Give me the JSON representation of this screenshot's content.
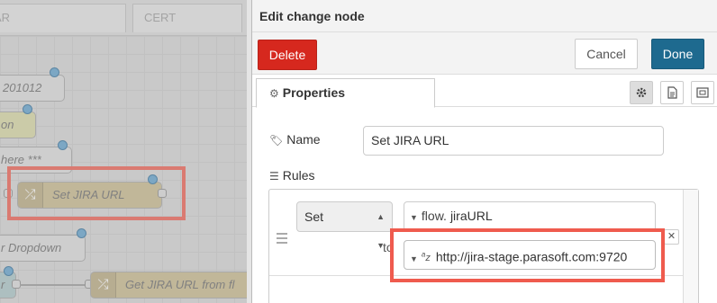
{
  "workspace_tabs": [
    "AR",
    "CERT"
  ],
  "canvas_nodes": [
    {
      "label": "201012"
    },
    {
      "label": "on"
    },
    {
      "label": "here ***"
    },
    {
      "label": "Set JIRA URL"
    },
    {
      "label": "r Dropdown"
    },
    {
      "label": "r"
    },
    {
      "label": "Get JIRA URL from fl"
    }
  ],
  "tray": {
    "title": "Edit change node",
    "delete_label": "Delete",
    "cancel_label": "Cancel",
    "done_label": "Done",
    "properties_tab": "Properties",
    "name_label": "Name",
    "name_value": "Set JIRA URL",
    "rules_label": "Rules",
    "rule": {
      "action": "Set",
      "target_type": "flow.",
      "target_value": "jiraURL",
      "to_label": "to",
      "value_type": "az",
      "value": "http://jira-stage.parasoft.com:9720"
    }
  },
  "colors": {
    "delete": "#d6281e",
    "done": "#1e6a8f",
    "highlight": "#ef5b4e",
    "status_dot": "#5ea0cd"
  }
}
